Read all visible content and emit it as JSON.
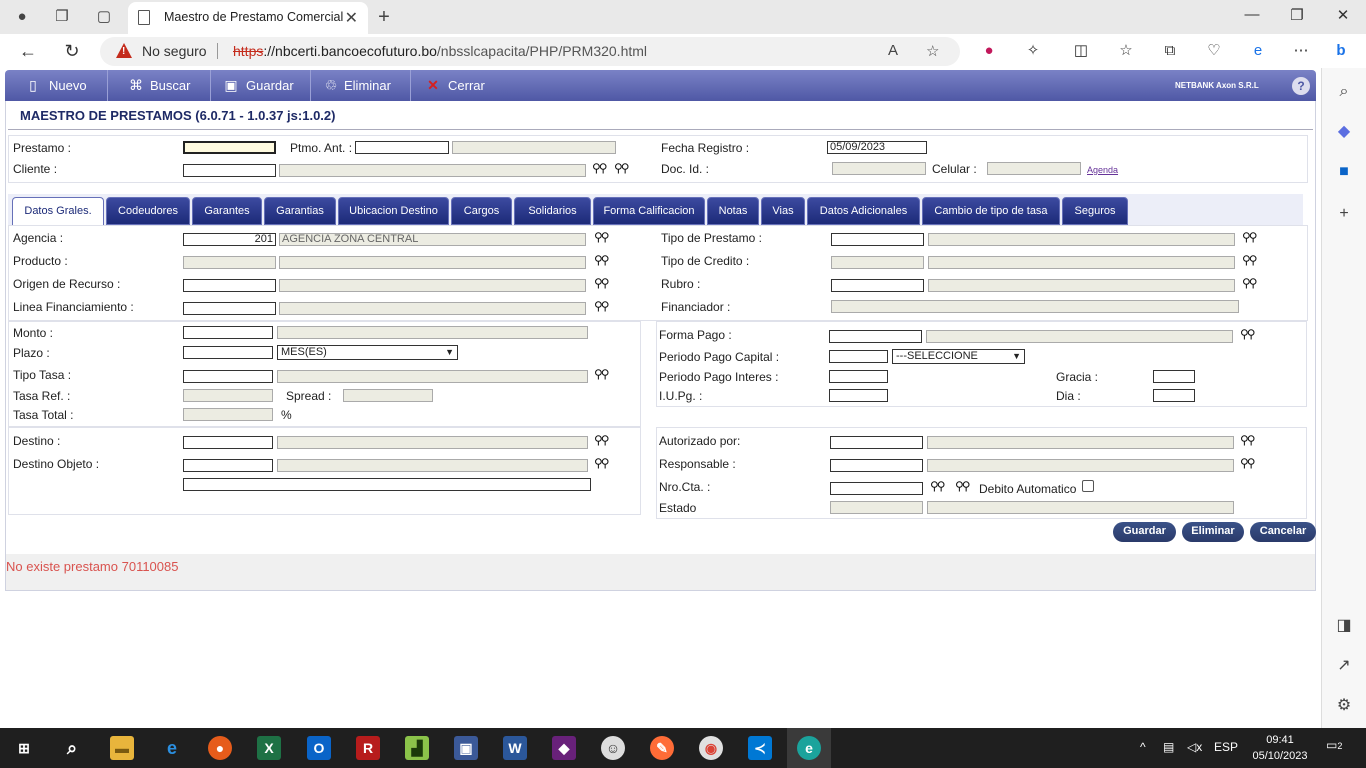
{
  "browser": {
    "tab_title": "Maestro de Prestamo Comercial",
    "security_label": "No seguro",
    "url_scheme": "https",
    "url_host": "://nbcerti.bancoecofuturo.bo",
    "url_path": "/nbsslcapacita/PHP/PRM320.html"
  },
  "toolbar": {
    "nuevo": "Nuevo",
    "buscar": "Buscar",
    "guardar": "Guardar",
    "eliminar": "Eliminar",
    "cerrar": "Cerrar",
    "brand": "NETBANK Axon S.R.L",
    "help": "?"
  },
  "page_title": "MAESTRO DE PRESTAMOS (6.0.71 - 1.0.37 js:1.0.2)",
  "header_form": {
    "prestamo_label": "Prestamo :",
    "ptmo_ant_label": "Ptmo. Ant. :",
    "fecha_registro_label": "Fecha Registro :",
    "fecha_registro_value": "05/09/2023",
    "cliente_label": "Cliente :",
    "doc_id_label": "Doc. Id. :",
    "celular_label": "Celular :",
    "agenda_link": "Agenda"
  },
  "tabs": [
    "Datos Grales.",
    "Codeudores",
    "Garantes",
    "Garantias",
    "Ubicacion Destino",
    "Cargos",
    "Solidarios",
    "Forma Calificacion",
    "Notas",
    "Vias",
    "Datos Adicionales",
    "Cambio de tipo de tasa",
    "Seguros"
  ],
  "general": {
    "agencia_label": "Agencia :",
    "agencia_code": "201",
    "agencia_name": "AGENCIA ZONA CENTRAL",
    "producto_label": "Producto :",
    "origen_label": "Origen de Recurso :",
    "linea_label": "Linea Financiamiento :",
    "tipo_prestamo_label": "Tipo de Prestamo :",
    "tipo_credito_label": "Tipo de Credito :",
    "rubro_label": "Rubro :",
    "financiador_label": "Financiador :"
  },
  "amounts": {
    "monto_label": "Monto :",
    "plazo_label": "Plazo :",
    "plazo_unit": "MES(ES)",
    "tipo_tasa_label": "Tipo Tasa :",
    "tasa_ref_label": "Tasa Ref. :",
    "spread_label": "Spread :",
    "tasa_total_label": "Tasa Total :",
    "percent": "%",
    "forma_pago_label": "Forma Pago :",
    "periodo_capital_label": "Periodo Pago Capital :",
    "periodo_capital_value": "---SELECCIONE",
    "periodo_interes_label": "Periodo Pago Interes :",
    "iupg_label": "I.U.Pg. :",
    "gracia_label": "Gracia :",
    "dia_label": "Dia :"
  },
  "destination": {
    "destino_label": "Destino :",
    "destino_objeto_label": "Destino Objeto :",
    "autorizado_label": "Autorizado por:",
    "responsable_label": "Responsable :",
    "nro_cta_label": "Nro.Cta. :",
    "debito_label": "Debito Automatico",
    "estado_label": "Estado"
  },
  "actions": {
    "guardar": "Guardar",
    "eliminar": "Eliminar",
    "cancelar": "Cancelar"
  },
  "status_message": "No existe prestamo 70110085",
  "taskbar": {
    "lang": "ESP",
    "time": "09:41",
    "date": "05/10/2023",
    "notifications": "2"
  },
  "colors": {
    "toolbar": "#5a62ad",
    "tab": "#1c2a78",
    "error": "#d9534f",
    "button": "#2f4478"
  }
}
